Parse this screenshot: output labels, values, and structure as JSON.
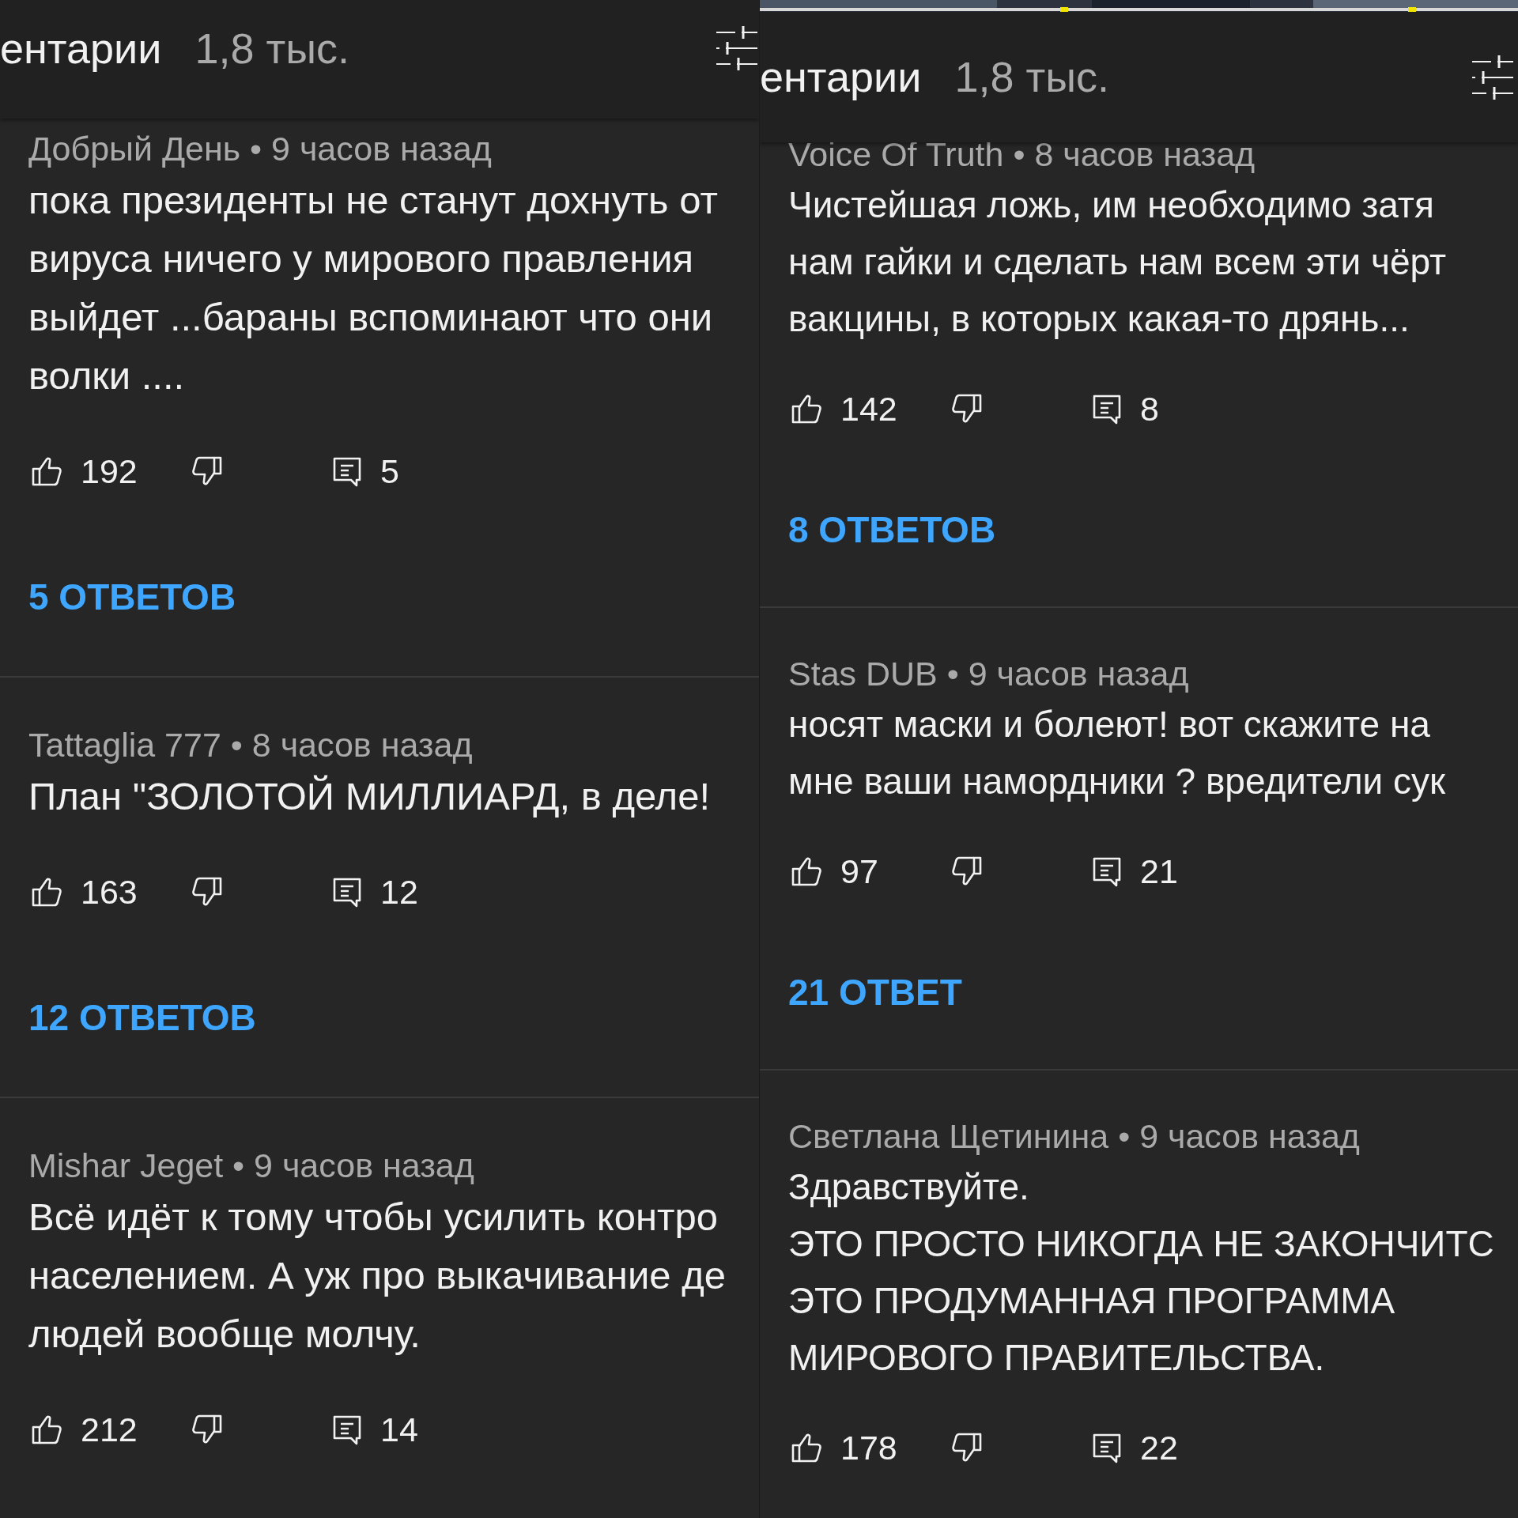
{
  "panels": [
    {
      "header": {
        "title": "ентарии",
        "count": "1,8 тыс."
      },
      "comments": [
        {
          "meta": "Добрый День • 9 часов назад",
          "lines": [
            "пока президенты не станут дохнуть от",
            "вируса ничего у мирового правления",
            "выйдет ...бараны вспоминают что они",
            "волки ...."
          ],
          "likes": "192",
          "reply_count": "5",
          "replies": "5 ОТВЕТОВ"
        },
        {
          "meta": "Tattaglia 777 • 8 часов назад",
          "lines": [
            "План \"ЗОЛОТОЙ МИЛЛИАРД, в деле!"
          ],
          "likes": "163",
          "reply_count": "12",
          "replies": "12 ОТВЕТОВ"
        },
        {
          "meta": "Mishar Jeget • 9 часов назад",
          "lines": [
            "Всё идёт к тому чтобы усилить контро",
            "населением. А уж про выкачивание де",
            "людей вообще молчу."
          ],
          "likes": "212",
          "reply_count": "14"
        }
      ]
    },
    {
      "video": {
        "kind": "picture"
      },
      "header": {
        "title": "ентарии",
        "count": "1,8 тыс."
      },
      "comments": [
        {
          "meta": "Voice Of Truth • 8 часов назад",
          "lines": [
            "Чистейшая ложь,  им необходимо затя",
            "нам гайки и сделать нам всем эти чёрт",
            "вакцины, в которых какая-то дрянь..."
          ],
          "likes": "142",
          "reply_count": "8",
          "replies": "8 ОТВЕТОВ"
        },
        {
          "meta": "Stas DUB • 9 часов назад",
          "lines": [
            "носят маски и болеют! вот скажите на",
            "мне ваши намордники ? вредители сук"
          ],
          "likes": "97",
          "reply_count": "21",
          "replies": "21 ОТВЕТ"
        },
        {
          "meta": "Светлана Щетинина • 9 часов назад",
          "lines": [
            "Здравствуйте.",
            "ЭТО ПРОСТО НИКОГДА НЕ ЗАКОНЧИТС",
            "ЭТО ПРОДУМАННАЯ ПРОГРАММА",
            "МИРОВОГО ПРАВИТЕЛЬСТВА."
          ],
          "likes": "178",
          "reply_count": "22"
        }
      ]
    }
  ]
}
